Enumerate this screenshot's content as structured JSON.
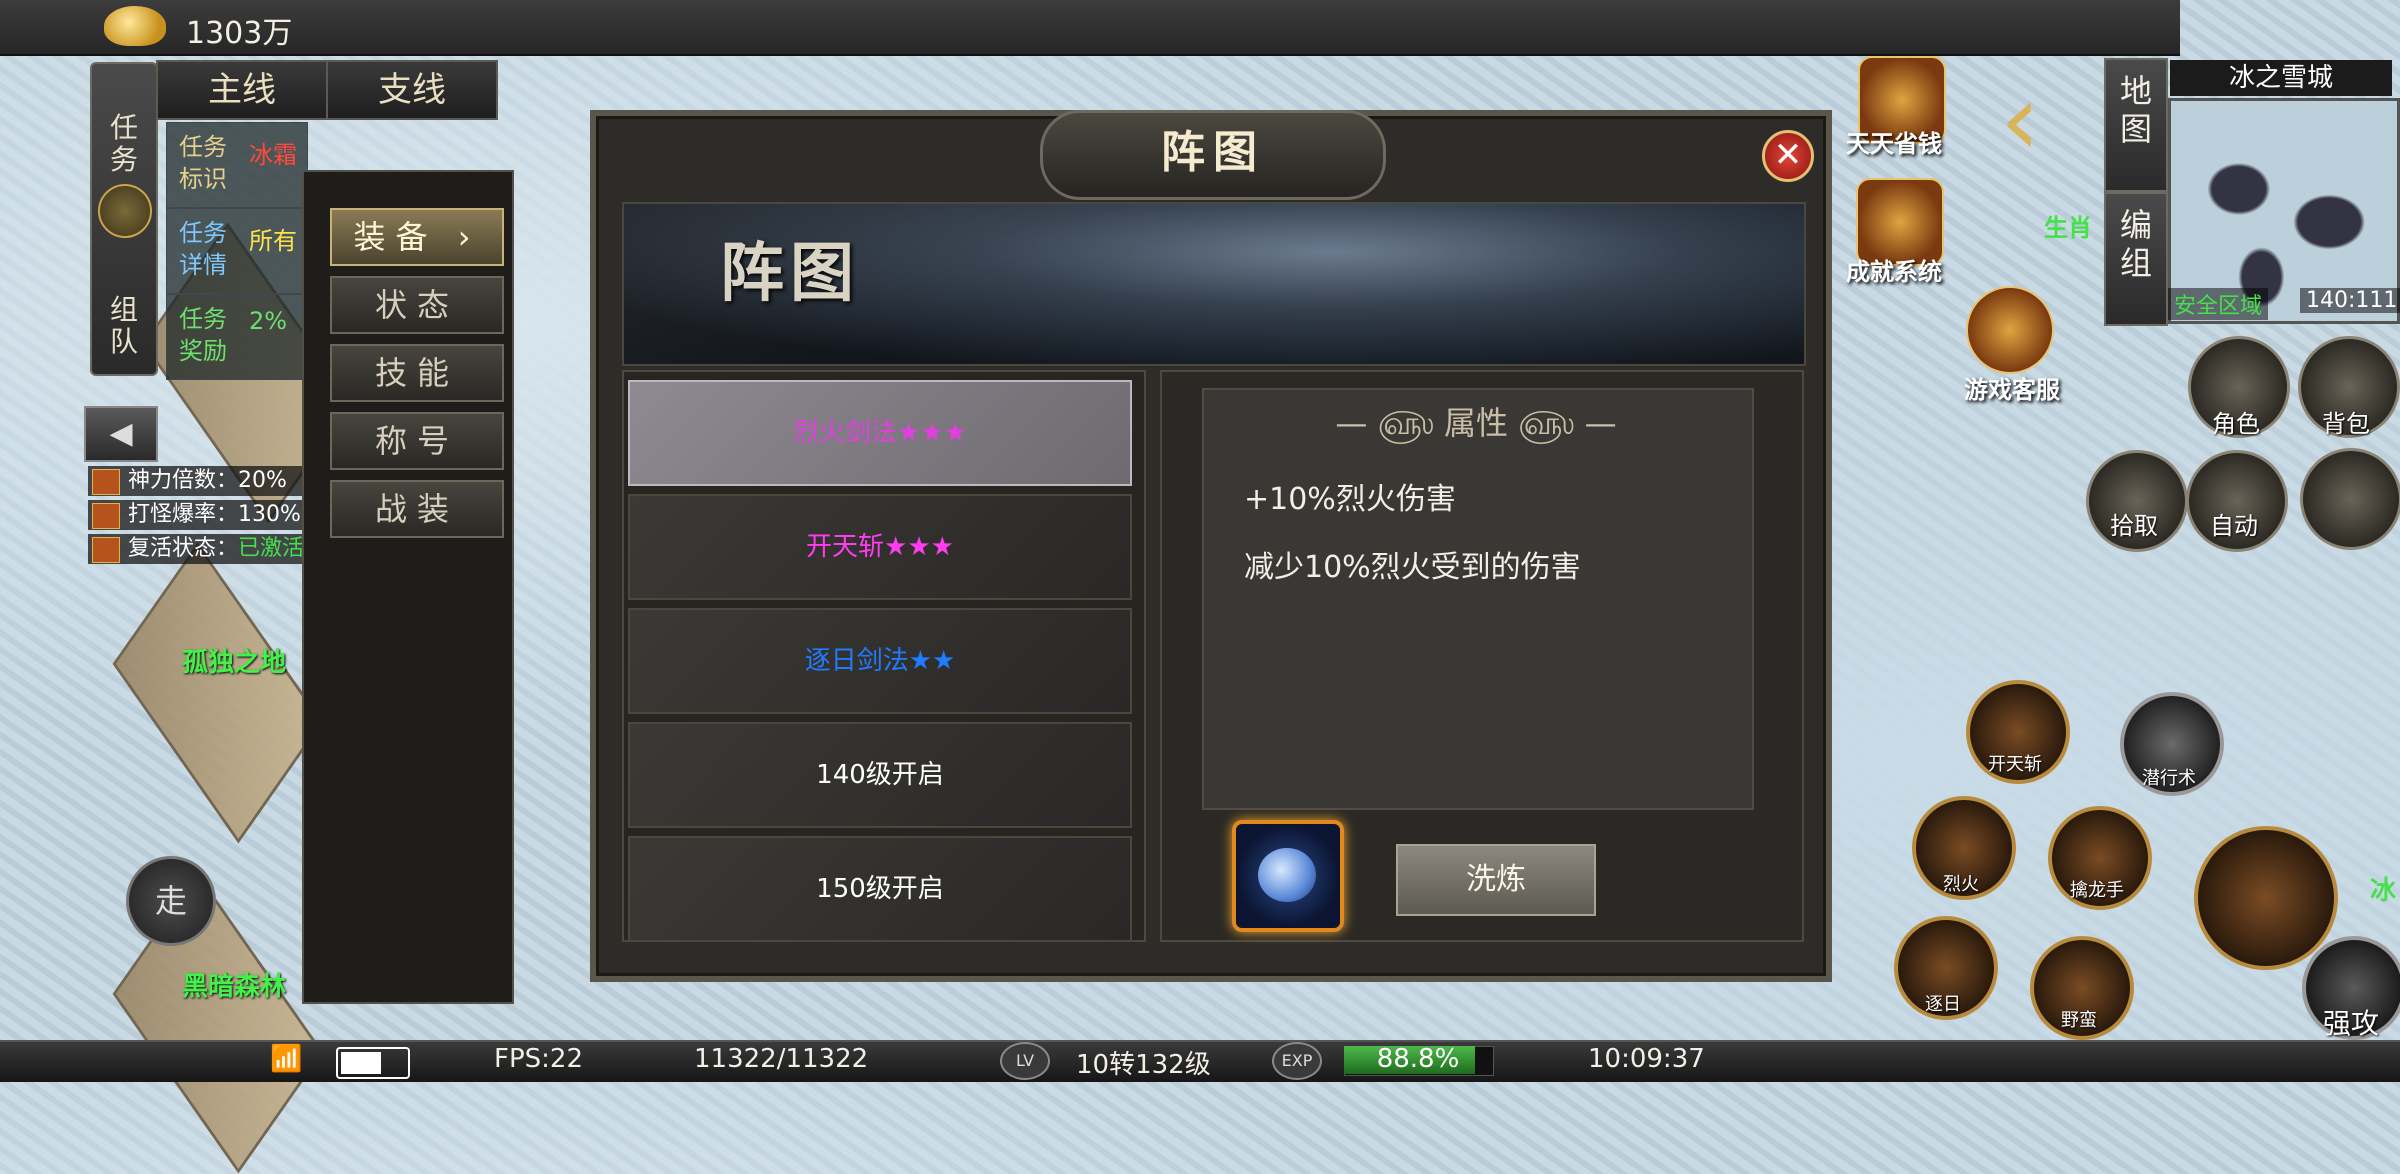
{
  "top": {
    "gold": "1303万"
  },
  "task_panel": {
    "col_task": "任务",
    "col_team": "组队",
    "tab_main": "主线",
    "tab_side": "支线",
    "rows": [
      {
        "label": "任务标识",
        "value": "冰霜"
      },
      {
        "label": "任务详情",
        "value": "所有"
      },
      {
        "label": "任务奖励",
        "value": "2%"
      }
    ]
  },
  "buffs": [
    {
      "label": "神力倍数：",
      "value": "20%"
    },
    {
      "label": "打怪爆率：",
      "value": "130%"
    },
    {
      "label": "复活状态：",
      "value": "已激活"
    }
  ],
  "side_menu": {
    "items": [
      "装备",
      "状态",
      "技能",
      "称号",
      "战装"
    ],
    "active": "装备"
  },
  "dialog": {
    "title": "阵图",
    "banner_title": "阵图",
    "formations": [
      {
        "label": "烈火剑法★★★",
        "color": "#e23fe0"
      },
      {
        "label": "开天斩★★★",
        "color": "#ff3cf0"
      },
      {
        "label": "逐日剑法★★",
        "color": "#1e7cff"
      },
      {
        "label": "140级开启",
        "color": "#ffffff"
      },
      {
        "label": "150级开启",
        "color": "#ffffff"
      }
    ],
    "attr_title": "属性",
    "attrs": [
      "+10%烈火伤害",
      "减少10%烈火受到的伤害"
    ],
    "refine_button": "洗炼"
  },
  "map": {
    "name": "冰之雪城",
    "safe_label": "安全区域",
    "coords": "140:111",
    "btn_map": "地图",
    "btn_group": "编组",
    "areas": [
      "孤独之地",
      "黑暗森林"
    ]
  },
  "top_right": {
    "save_money": "天天省钱",
    "achievement": "成就系统",
    "service": "游戏客服",
    "side_label": "生肖"
  },
  "actions": {
    "role": "角色",
    "bag": "背包",
    "pickup": "拾取",
    "auto": "自动",
    "walk": "走"
  },
  "skills": {
    "kaitian": "开天斩",
    "qianxing": "潜行术",
    "liehuo": "烈火",
    "shenglong": "擒龙手",
    "zhuri": "逐日",
    "yeman": "野蛮",
    "qianggong": "强攻",
    "bing": "冰"
  },
  "bottom": {
    "fps": "FPS:22",
    "hp": "11322/11322",
    "lv_badge": "LV",
    "level": "10转132级",
    "exp_badge": "EXP",
    "exp": "88.8%",
    "exp_fraction": 0.888,
    "time": "10:09:37"
  }
}
